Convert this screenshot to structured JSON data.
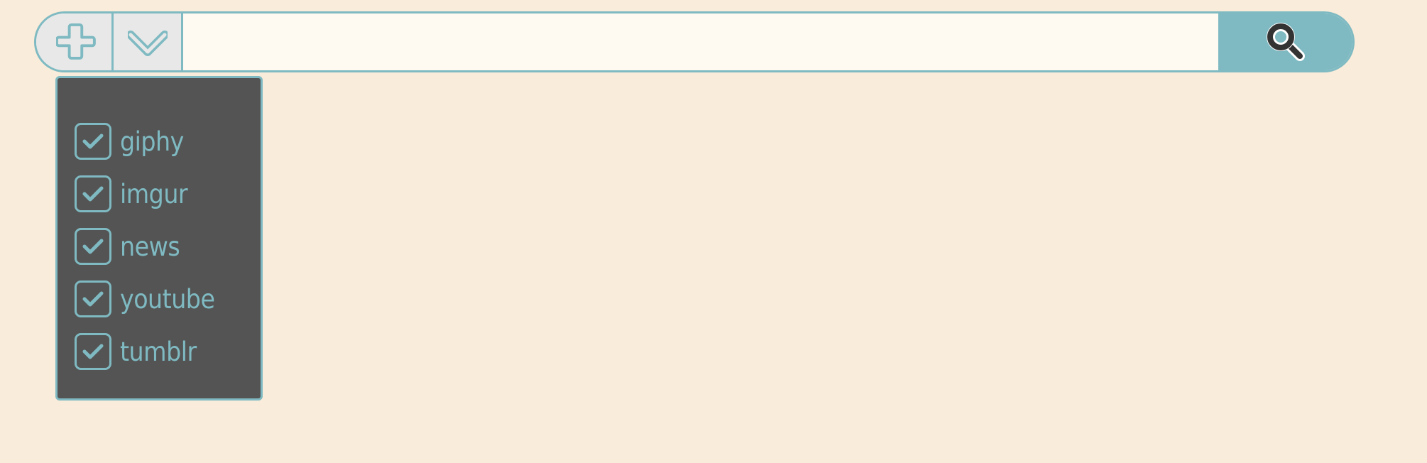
{
  "search_bar": {
    "add_icon": "plus-icon",
    "dropdown_icon": "chevron-down-icon",
    "query_value": "",
    "search_icon": "magnifier-icon"
  },
  "source_menu": {
    "items": [
      {
        "label": "giphy",
        "checked": true
      },
      {
        "label": "imgur",
        "checked": true
      },
      {
        "label": "news",
        "checked": true
      },
      {
        "label": "youtube",
        "checked": true
      },
      {
        "label": "tumblr",
        "checked": true
      }
    ]
  },
  "colors": {
    "background": "#f9ecda",
    "accent": "#7fbac2",
    "menu_background": "#545454",
    "button_background": "#e8e8e8",
    "input_background": "#fef9f1",
    "search_icon": "#333333"
  }
}
